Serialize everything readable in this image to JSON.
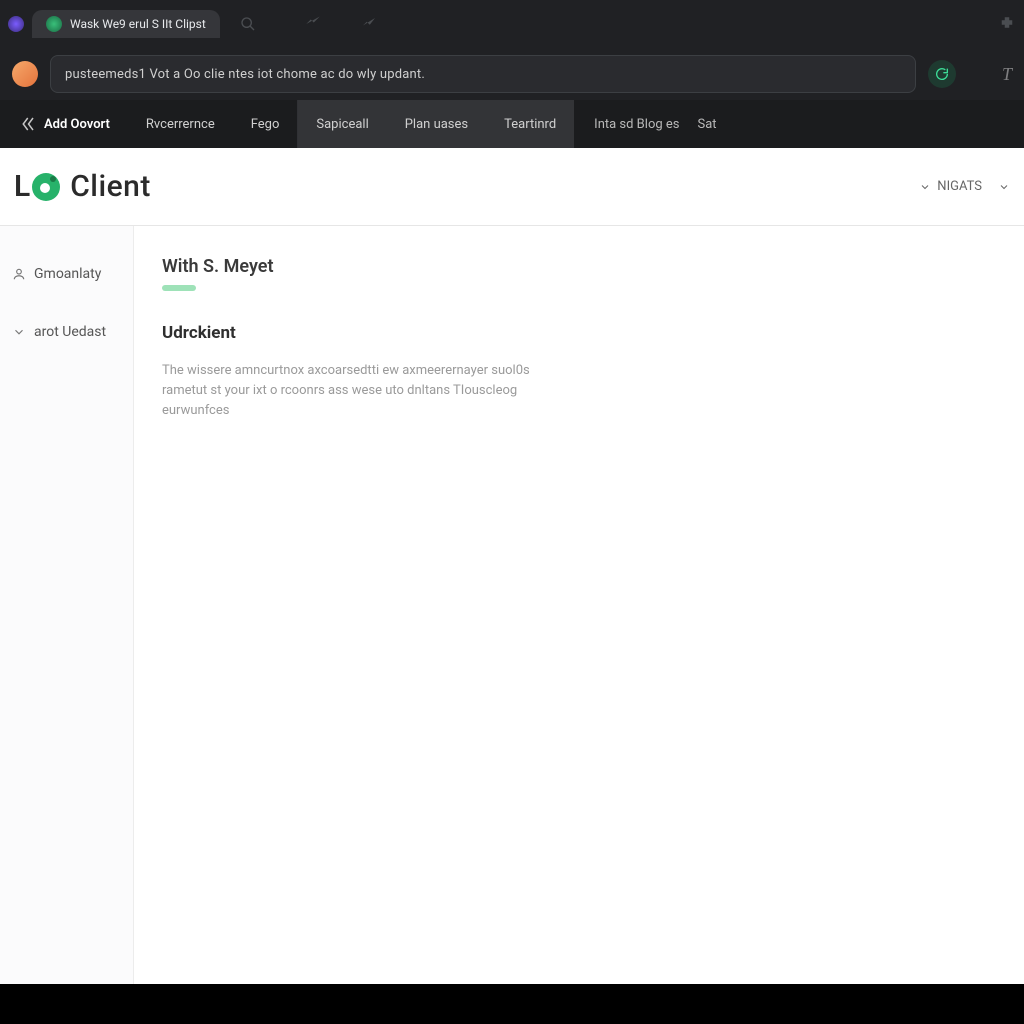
{
  "browser": {
    "tab_title": "Wask We9 erul S IIt Clipst",
    "address_text": "pusteemeds1 Vot a Oo clie ntes iot chome ac do wly updant."
  },
  "app_nav": {
    "primary": "Add Oovort",
    "items": [
      "Rvcerrernce",
      "Fego",
      "Sapiceall",
      "Plan uases",
      "Teartinrd"
    ],
    "right_items": [
      "Inta sd Blog es",
      "Sat"
    ]
  },
  "brand": {
    "name": "Client"
  },
  "header": {
    "dropdown_label": "NIGATS"
  },
  "sidebar": {
    "items": [
      {
        "label": "Gmoanlaty"
      },
      {
        "label": "arot Uedast"
      }
    ]
  },
  "content": {
    "page_title": "With S. Meyet",
    "section_title": "Udrckient",
    "section_body": "The wissere amncurtnox axcoarsedtti ew axmeerernayer suol0s rametut st your ixt o rcoonrs ass wese uto dnltans TIouscleog eurwunfces"
  }
}
